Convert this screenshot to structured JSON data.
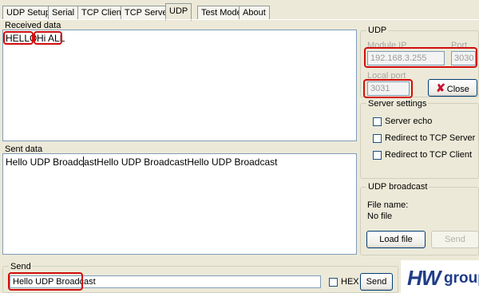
{
  "tabs": [
    {
      "label": "UDP Setup"
    },
    {
      "label": "Serial"
    },
    {
      "label": "TCP Client"
    },
    {
      "label": "TCP Server"
    },
    {
      "label": "UDP"
    },
    {
      "label": "Test Mode"
    },
    {
      "label": "About"
    }
  ],
  "received": {
    "label": "Received data",
    "text_1": "HELLO",
    "text_2": "Hi ALL"
  },
  "sent": {
    "label": "Sent data",
    "text_a": "Hello UDP Broadc",
    "text_b": "astHello UDP BroadcastHello UDP Broadcast"
  },
  "udp": {
    "title": "UDP",
    "module_ip_label": "Module IP",
    "module_ip_value": "192.168.3.255",
    "port_label": "Port",
    "port_value": "3030",
    "local_port_label": "Local port",
    "local_port_value": "3031",
    "close_label": "Close"
  },
  "server_settings": {
    "title": "Server settings",
    "server_echo": "Server echo",
    "redirect_tcp_server": "Redirect to TCP Server",
    "redirect_tcp_client": "Redirect to TCP Client"
  },
  "udp_broadcast": {
    "title": "UDP broadcast",
    "file_name_label": "File name:",
    "file_name_value": "No file",
    "load_file_label": "Load file",
    "send_label": "Send"
  },
  "send": {
    "label": "Send",
    "input_value": "Hello UDP Broadcast",
    "hex_label": "HEX",
    "send_button_label": "Send"
  },
  "logo": {
    "text_1": "HW",
    "text_2": "group"
  },
  "colors": {
    "highlight": "#D10E0E",
    "window_bg": "#ECE9D8",
    "input_border": "#7F9DB9",
    "close_x": "#C8102E"
  }
}
